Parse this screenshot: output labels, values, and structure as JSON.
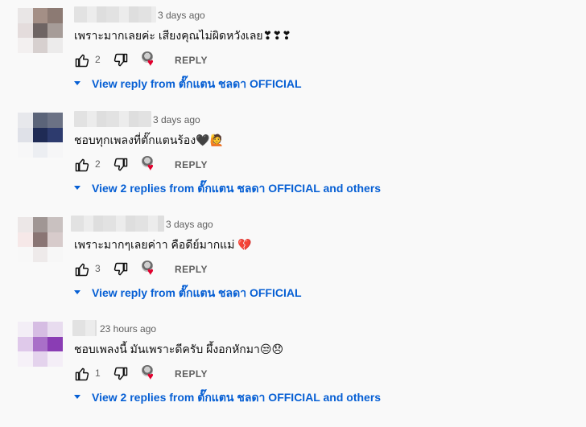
{
  "icons": {
    "like": "thumbs-up-icon",
    "dislike": "thumbs-down-icon",
    "hearted": "creator-heart-icon",
    "expand": "caret-down-icon"
  },
  "colors": {
    "link": "#065fd4",
    "muted": "#606060",
    "heart": "#e1002d"
  },
  "comments": [
    {
      "time": "3 days ago",
      "text": "เพราะมากเลยค่ะ เสียงคุณไม่ผิดหวังเลย",
      "emoji": "❣❣❣",
      "likes": "2",
      "reply_label": "REPLY",
      "replies_link": "View reply from ตั๊กแตน ชลดา OFFICIAL"
    },
    {
      "time": "3 days ago",
      "text": "ชอบทุกเพลงที่ตั๊กแตนร้อง",
      "emoji": "🖤🙋",
      "likes": "2",
      "reply_label": "REPLY",
      "replies_link": "View 2 replies from ตั๊กแตน ชลดา OFFICIAL and others"
    },
    {
      "time": "3 days ago",
      "text": "เพราะมากๆเลยค่าา คือดีย์มากแม่",
      "emoji": "💔",
      "likes": "3",
      "reply_label": "REPLY",
      "replies_link": "View reply from ตั๊กแตน ชลดา OFFICIAL"
    },
    {
      "time": "23 hours ago",
      "text": "ชอบเพลงนี้ มันเพราะดีครับ ผึ้งอกหักมา",
      "emoji": "😒😞",
      "likes": "1",
      "reply_label": "REPLY",
      "replies_link": "View 2 replies from ตั๊กแตน ชลดา OFFICIAL and others"
    }
  ]
}
